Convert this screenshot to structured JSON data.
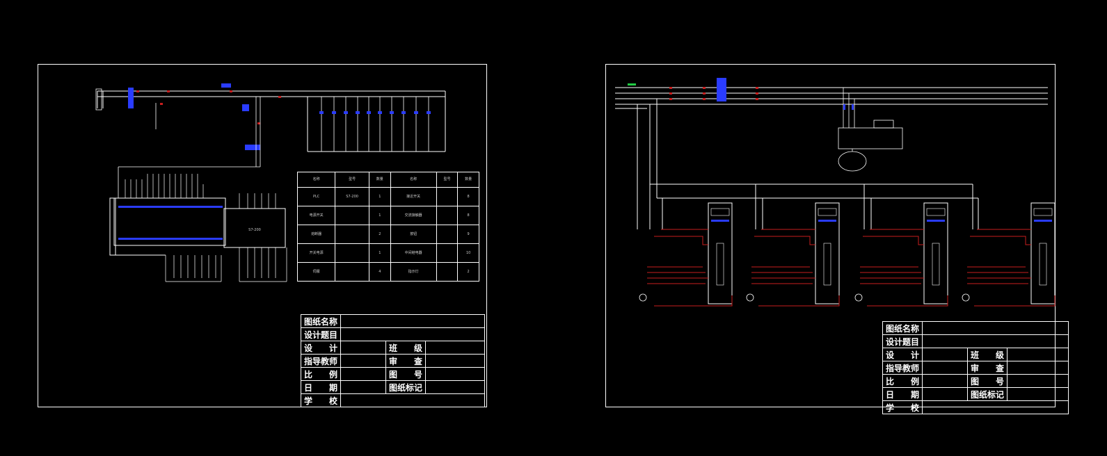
{
  "sheets": [
    {
      "bom": {
        "headers": [
          "名称",
          "型号",
          "数量",
          "名称",
          "型号",
          "数量"
        ],
        "rows": [
          [
            "PLC",
            "S7-200",
            "1",
            "接近开关",
            "",
            "8"
          ],
          [
            "电源开关",
            "",
            "1",
            "交流接触器",
            "",
            "8"
          ],
          [
            "熔断器",
            "",
            "2",
            "按钮",
            "",
            "9"
          ],
          [
            "开关电源",
            "",
            "1",
            "中间继电器",
            "",
            "10"
          ],
          [
            "伺服",
            "",
            "4",
            "指示灯",
            "",
            "2"
          ]
        ],
        "plc_label": "S7-200"
      },
      "title_block": {
        "drawing_name": "图纸名称",
        "design_topic": "设计题目",
        "design": "设　　计",
        "class": "班　　级",
        "instructor": "指导教师",
        "review": "审　　查",
        "scale": "比　　例",
        "drawing_no": "图　　号",
        "date": "日　　期",
        "drawing_mark": "图纸标记",
        "school": "学　　校"
      }
    },
    {
      "title_block": {
        "drawing_name": "图纸名称",
        "design_topic": "设计题目",
        "design": "设　　计",
        "class": "班　　级",
        "instructor": "指导教师",
        "review": "审　　查",
        "scale": "比　　例",
        "drawing_no": "图　　号",
        "date": "日　　期",
        "drawing_mark": "图纸标记",
        "school": "学　　校"
      }
    }
  ],
  "colors": {
    "line": "#ffffff",
    "wire_red": "#c81e1e",
    "symbol_blue": "#2a3cff",
    "label_green": "#22cc44"
  }
}
